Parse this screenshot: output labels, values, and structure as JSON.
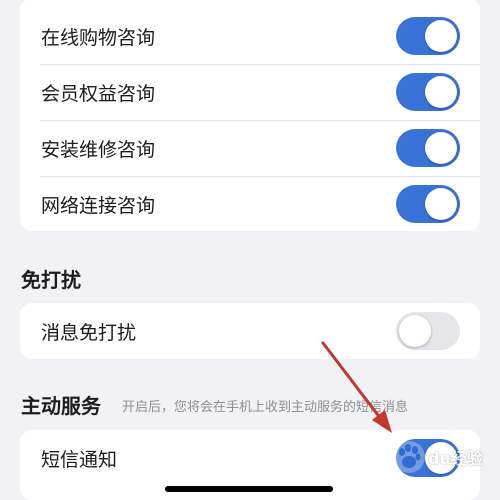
{
  "colors": {
    "accent": "#3a73d8",
    "toggle_off": "#e5e5ea",
    "background": "#f2f2f6",
    "arrow": "#c0392b"
  },
  "consult_section": {
    "items": [
      {
        "label": "在线购物咨询",
        "enabled": true
      },
      {
        "label": "会员权益咨询",
        "enabled": true
      },
      {
        "label": "安装维修咨询",
        "enabled": true
      },
      {
        "label": "网络连接咨询",
        "enabled": true
      }
    ]
  },
  "dnd_section": {
    "title": "免打扰",
    "items": [
      {
        "label": "消息免打扰",
        "enabled": false
      }
    ]
  },
  "active_service_section": {
    "title": "主动服务",
    "note": "开启后，您将会在手机上收到主动服务的短信消息",
    "items": [
      {
        "label": "短信通知",
        "enabled": true
      }
    ]
  },
  "watermark": {
    "icon": "baidu-paw-icon",
    "text": "du经验"
  }
}
